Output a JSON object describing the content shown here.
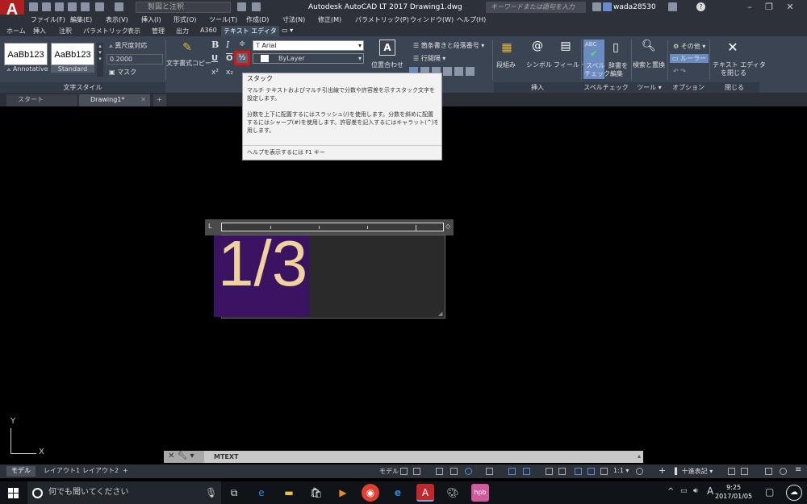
{
  "app": {
    "logo_text": "A",
    "logo_sub": "LT",
    "title": "Autodesk AutoCAD LT 2017    Drawing1.dwg",
    "workspace": "製図と注釈",
    "search_placeholder": "キーワードまたは語句を入力",
    "user": "wada28530",
    "help": "?"
  },
  "menubar": [
    "ファイル(F)",
    "編集(E)",
    "表示(V)",
    "挿入(I)",
    "形式(O)",
    "ツール(T)",
    "作成(D)",
    "寸法(N)",
    "修正(M)",
    "パラメトリック(P)",
    "ウィンドウ(W)",
    "ヘルプ(H)"
  ],
  "ribbon_tabs": [
    "ホーム",
    "挿入",
    "注釈",
    "パラメトリック",
    "表示",
    "管理",
    "出力",
    "A360",
    "テキスト エディタ"
  ],
  "active_ribbon_tab": "テキスト エディタ",
  "ribbon": {
    "style_swatch_1": "AaBb123",
    "style_swatch_2": "AaBb123",
    "style_cap_1": "Annotative",
    "style_cap_2": "Standard",
    "annotative_label": "異尺度対応",
    "height_value": "0.2000",
    "mask_label": "マスク",
    "panel_style": "文字スタイル",
    "match_label": "文字書式コピー",
    "font": "Arial",
    "color": "ByLayer",
    "justify_label": "位置合わせ",
    "bullets_label": "箇条書きと段落番号",
    "line_spacing_label": "行間隔",
    "columns_label": "段組み",
    "symbol_label": "シンボル",
    "field_label": "フィールド",
    "panel_insert": "挿入",
    "spell_label_1": "スペル",
    "spell_label_2": "チェック",
    "dict_label_1": "辞書を",
    "dict_label_2": "編集",
    "panel_spell": "スペルチェック",
    "find_label": "検索と置換",
    "panel_tools": "ツール",
    "more_label": "その他",
    "ruler_label": "ルーラー",
    "panel_options": "オプション",
    "close_label_1": "テキスト エディタ",
    "close_label_2": "を閉じる",
    "panel_close": "閉じる"
  },
  "doc_tabs": [
    "スタート",
    "Drawing1*"
  ],
  "tooltip": {
    "title": "スタック",
    "lines": [
      "マルチ テキストおよびマルチ引出線で分数や許容差を示すスタック文字を",
      "設定します。",
      "",
      "分数を上下に配置するにはスラッシュ(/)を使用します。分数を斜めに配置",
      "するにはシャープ(#)を使用します。許容差を記入するにはキャラット(^)を使",
      "用します。"
    ],
    "help": "ヘルプを表示するには F1 キー"
  },
  "editor": {
    "text": "1/3"
  },
  "ucs": {
    "x": "X",
    "y": "Y"
  },
  "command_line": {
    "text": "MTEXT"
  },
  "layout_tabs": [
    "モデル",
    "レイアウト1",
    "レイアウト2"
  ],
  "status": {
    "model": "モデル",
    "scale": "1:1",
    "units": "十進表記"
  },
  "taskbar": {
    "search": "何でも聞いてください",
    "time": "9:25",
    "date": "2017/01/05",
    "ime": "A"
  },
  "colors": {
    "ribbon": "#3b4453",
    "highlight": "#3a1462",
    "text": "#f0d29b",
    "stack_border": "#e01010"
  }
}
